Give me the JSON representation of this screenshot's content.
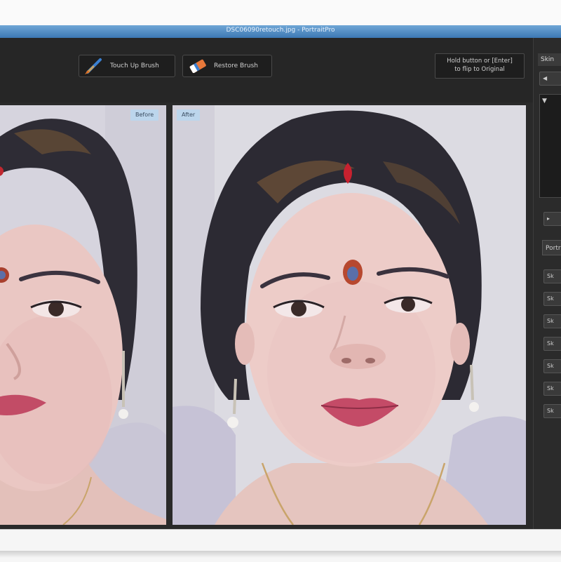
{
  "window": {
    "title": "DSC06090retouch.jpg - PortraitPro"
  },
  "toolbar": {
    "touch_up_label": "Touch Up Brush",
    "restore_label": "Restore Brush",
    "hold_line1": "Hold button or [Enter]",
    "hold_line2": "to flip to Original"
  },
  "canvas": {
    "before_label": "Before",
    "after_label": "After"
  },
  "right_panel": {
    "tab_label": "Skin",
    "section_label": "Portrait",
    "rows": [
      "Sk",
      "Sk",
      "Sk",
      "Sk",
      "Sk",
      "Sk",
      "Sk"
    ]
  },
  "colors": {
    "app_bg": "#2d2d2d",
    "title_bar": "#4a88c4",
    "tag_bg": "#bcd6ec"
  }
}
